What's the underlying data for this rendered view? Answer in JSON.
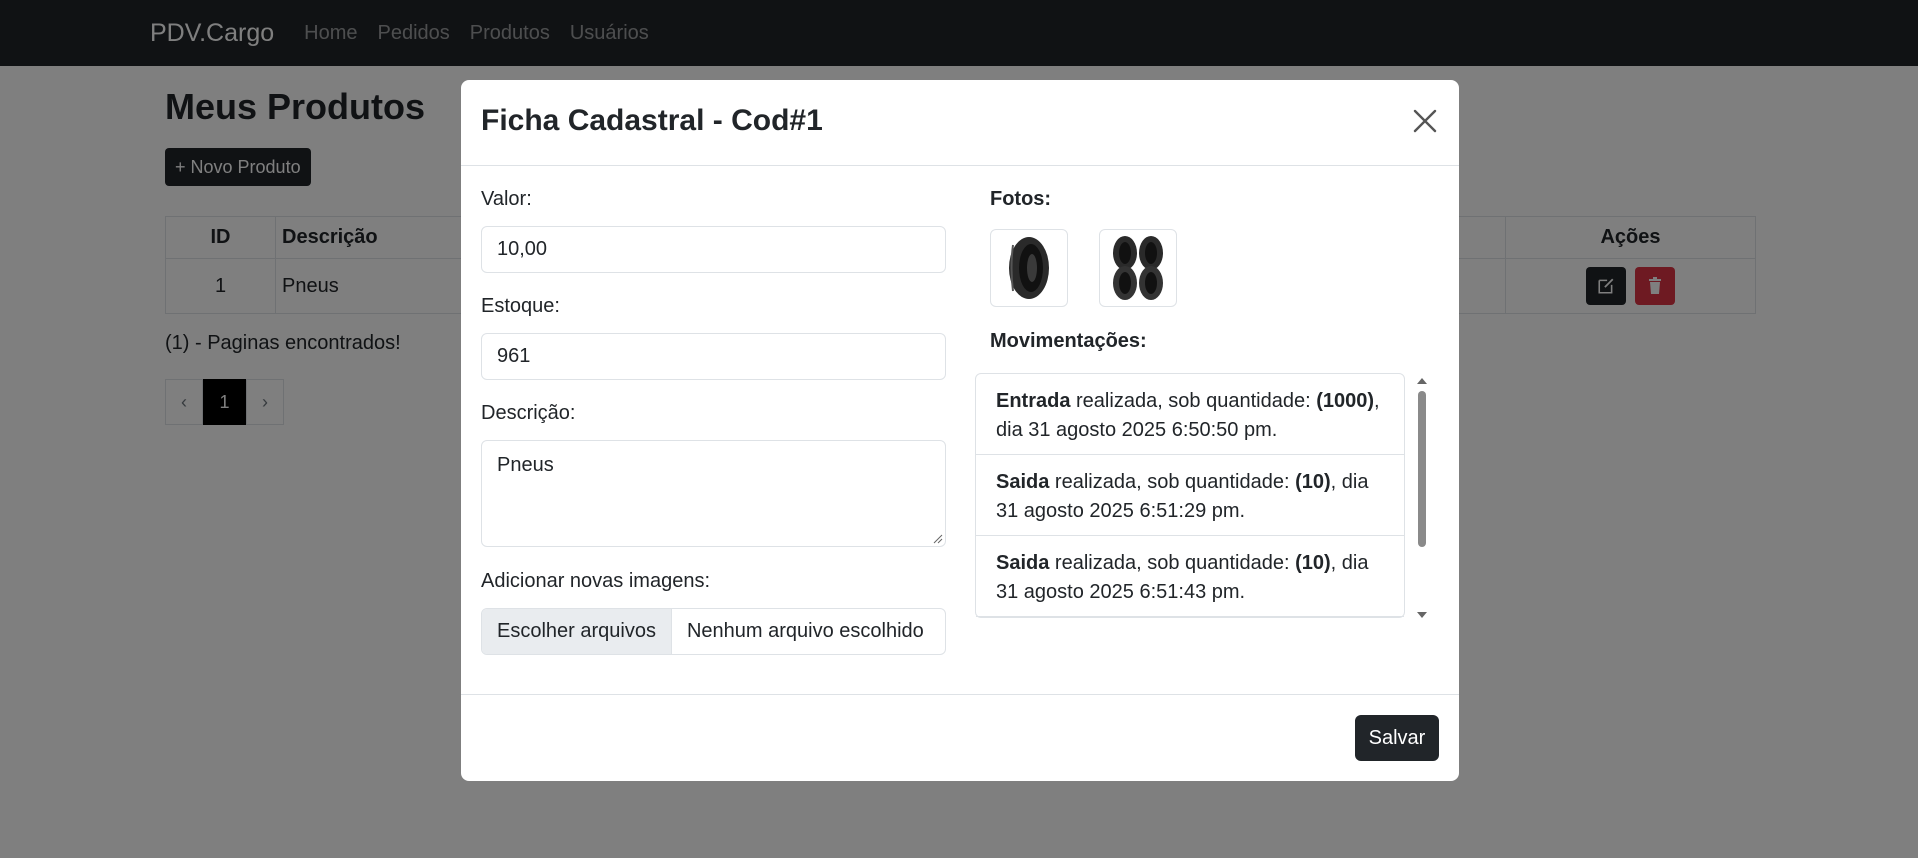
{
  "navbar": {
    "brand": "PDV.Cargo",
    "links": [
      "Home",
      "Pedidos",
      "Produtos",
      "Usuários"
    ]
  },
  "page": {
    "title": "Meus Produtos",
    "new_button": "+ Novo Produto",
    "table": {
      "headers": [
        "ID",
        "Descrição",
        "Ações"
      ],
      "rows": [
        {
          "id": "1",
          "descricao": "Pneus"
        }
      ]
    },
    "found_text": "(1) - Paginas encontrados!",
    "pagination": {
      "prev": "‹",
      "current": "1",
      "next": "›"
    }
  },
  "modal": {
    "title": "Ficha Cadastral - Cod#1",
    "valor_label": "Valor:",
    "valor_value": "10,00",
    "estoque_label": "Estoque:",
    "estoque_value": "961",
    "descricao_label": "Descrição:",
    "descricao_value": "Pneus",
    "imagens_label": "Adicionar novas imagens:",
    "file_button": "Escolher arquivos",
    "file_status": "Nenhum arquivo escolhido",
    "fotos_label": "Fotos:",
    "movimentacoes_label": "Movimentações:",
    "movimentacoes": [
      {
        "tipo": "Entrada",
        "texto": " realizada, sob quantidade: ",
        "qtd": "(1000)",
        "data": ", dia 31 agosto 2025 6:50:50 pm."
      },
      {
        "tipo": "Saida",
        "texto": " realizada, sob quantidade: ",
        "qtd": "(10)",
        "data": ", dia 31 agosto 2025 6:51:29 pm."
      },
      {
        "tipo": "Saida",
        "texto": " realizada, sob quantidade: ",
        "qtd": "(10)",
        "data": ", dia 31 agosto 2025 6:51:43 pm."
      }
    ],
    "save_button": "Salvar"
  },
  "icons": {
    "close": "close-icon",
    "edit": "edit-icon",
    "delete": "trash-icon",
    "tire": "tire-icon"
  },
  "colors": {
    "navbar": "#212529",
    "danger": "#dc3545",
    "primary_dark": "#212529"
  }
}
